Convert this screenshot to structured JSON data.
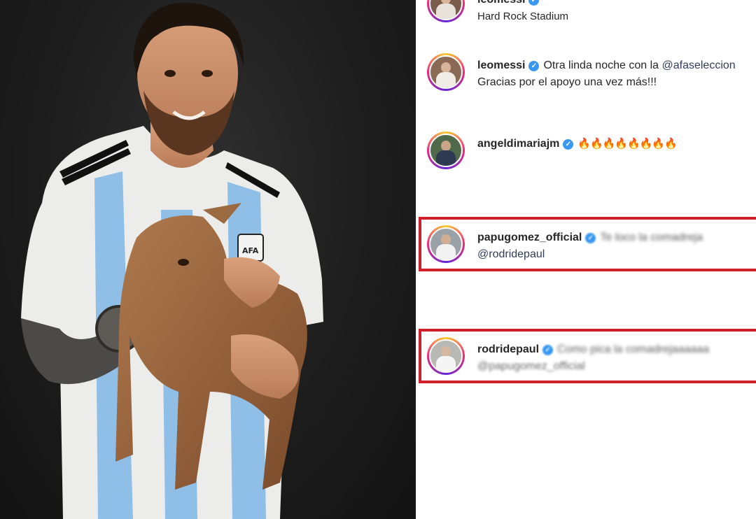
{
  "post": {
    "location_user": "leomessi",
    "location": "Hard Rock Stadium"
  },
  "comments": [
    {
      "username": "leomessi",
      "verified": true,
      "text_line1": "Otra linda noche con la",
      "mention_line1": "@afaseleccion",
      "text_line2": "Gracias por el apoyo una vez más!!!"
    },
    {
      "username": "angeldimariajm",
      "verified": true,
      "text_line1": "🔥🔥🔥🔥🔥🔥🔥🔥"
    },
    {
      "username": "papugomez_official",
      "verified": true,
      "text_line1": "Te loco la comadreja",
      "text_line1_blurred": true,
      "mention_line2": "@rodridepaul",
      "highlighted": true
    },
    {
      "username": "rodridepaul",
      "verified": true,
      "text_line1": "Como pica la comadrejaaaaaa",
      "text_line1_blurred": true,
      "mention_line2": "@papugomez_official",
      "mention_line2_blurred": true,
      "highlighted": true
    }
  ],
  "colors": {
    "highlight_border": "#d0202a",
    "verified_badge": "#3897f0",
    "story_ring": [
      "#f9ce34",
      "#ee2a7b",
      "#6228d7"
    ],
    "photo_background": "#1d1d1d"
  },
  "icons": {
    "verified": "verified-badge-icon"
  }
}
